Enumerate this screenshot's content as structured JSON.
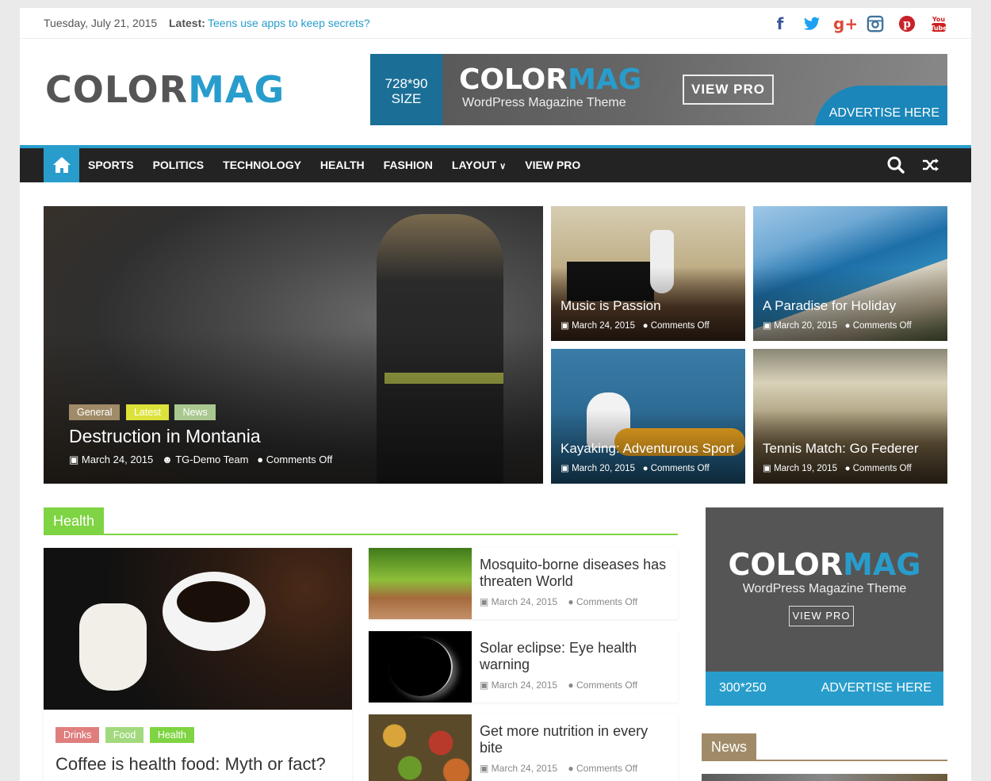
{
  "topbar": {
    "date": "Tuesday, July 21, 2015",
    "latest_label": "Latest:",
    "latest_link": "Teens use apps to keep secrets?",
    "social": [
      "facebook-icon",
      "twitter-icon",
      "google-plus-icon",
      "instagram-icon",
      "pinterest-icon",
      "youtube-icon"
    ]
  },
  "header": {
    "logo_a": "COLOR",
    "logo_b": "MAG",
    "banner": {
      "size_line1": "728*90",
      "size_line2": "SIZE",
      "title_a": "COLOR",
      "title_b": "MAG",
      "subtitle": "WordPress Magazine Theme",
      "button": "VIEW PRO",
      "advertise": "ADVERTISE HERE"
    }
  },
  "nav": {
    "items": [
      "SPORTS",
      "POLITICS",
      "TECHNOLOGY",
      "HEALTH",
      "FASHION",
      "LAYOUT",
      "VIEW PRO"
    ]
  },
  "featured": {
    "main": {
      "categories": [
        "General",
        "Latest",
        "News"
      ],
      "title": "Destruction in Montania",
      "date": "March 24, 2015",
      "author": "TG-Demo Team",
      "comments": "Comments Off"
    },
    "small": [
      {
        "title": "Music is Passion",
        "date": "March 24, 2015",
        "comments": "Comments Off"
      },
      {
        "title": "A Paradise for Holiday",
        "date": "March 20, 2015",
        "comments": "Comments Off"
      },
      {
        "title": "Kayaking: Adventurous Sport",
        "date": "March 20, 2015",
        "comments": "Comments Off"
      },
      {
        "title": "Tennis Match: Go Federer",
        "date": "March 19, 2015",
        "comments": "Comments Off"
      }
    ]
  },
  "health": {
    "section_title": "Health",
    "main": {
      "categories": [
        "Drinks",
        "Food",
        "Health"
      ],
      "title": "Coffee is health food: Myth or fact?"
    },
    "list": [
      {
        "title": "Mosquito-borne diseases has threaten World",
        "date": "March 24, 2015",
        "comments": "Comments Off"
      },
      {
        "title": "Solar eclipse: Eye health warning",
        "date": "March 24, 2015",
        "comments": "Comments Off"
      },
      {
        "title": "Get more nutrition in every bite",
        "date": "March 24, 2015",
        "comments": "Comments Off"
      }
    ]
  },
  "sidebar": {
    "ad": {
      "title_a": "COLOR",
      "title_b": "MAG",
      "subtitle": "WordPress Magazine Theme",
      "button": "VIEW PRO",
      "size": "300*250",
      "advertise": "ADVERTISE HERE"
    },
    "news_title": "News"
  },
  "colors": {
    "accent": "#289dcc",
    "health": "#7ed442",
    "news": "#a08b68"
  }
}
